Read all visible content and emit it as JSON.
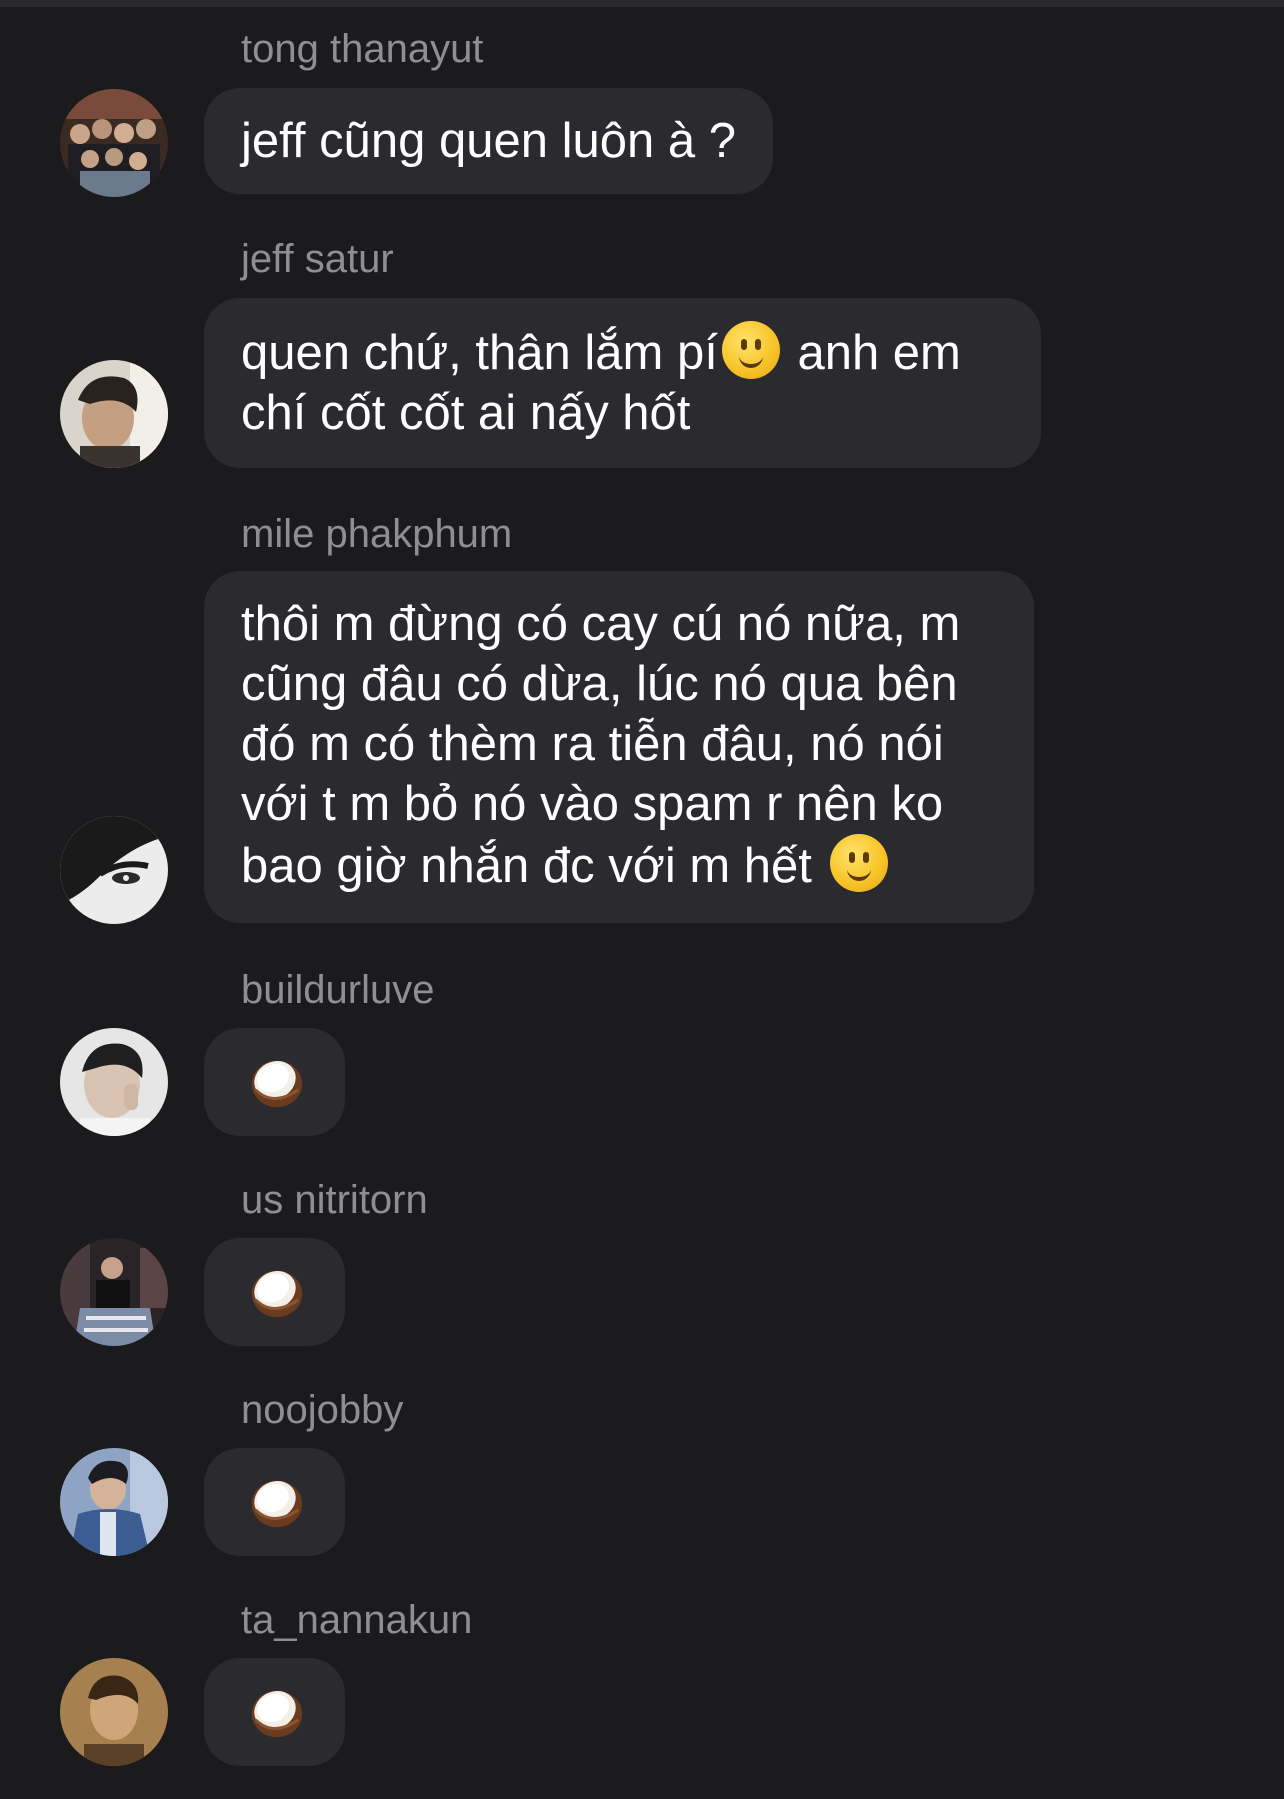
{
  "messages": [
    {
      "sender": "tong thanayut",
      "text": "jeff cũng quen luôn à ?",
      "avatar": "group-photo-avatar"
    },
    {
      "sender": "jeff satur",
      "text_part1": "quen chứ, thân lắm pí",
      "text_part2": " anh em\nchí cốt cốt ai nấy hốt",
      "inline_emoji": "slightly-smiling-face",
      "avatar": "portrait-avatar"
    },
    {
      "sender": "mile phakphum",
      "text_part1": "thôi m đừng có cay cú nó nữa, m\ncũng đâu có dừa, lúc nó qua bên\nđó m có thèm ra tiễn đâu, nó nói\nvới t m bỏ nó vào spam r nên ko\nbao giờ nhắn đc với m hết ",
      "inline_emoji": "slightly-smiling-face",
      "avatar": "black-white-eye-avatar"
    },
    {
      "sender": "buildurluve",
      "emoji": "coconut",
      "avatar": "portrait-avatar"
    },
    {
      "sender": "us nitritorn",
      "emoji": "coconut",
      "avatar": "portrait-avatar"
    },
    {
      "sender": "noojobby",
      "emoji": "coconut",
      "avatar": "portrait-avatar"
    },
    {
      "sender": "ta_nannakun",
      "emoji": "coconut",
      "avatar": "portrait-avatar"
    }
  ],
  "colors": {
    "background": "#1b1b1e",
    "bubble": "#2b2b2f",
    "sender_name": "#8e8e94",
    "message_text": "#ffffff"
  }
}
